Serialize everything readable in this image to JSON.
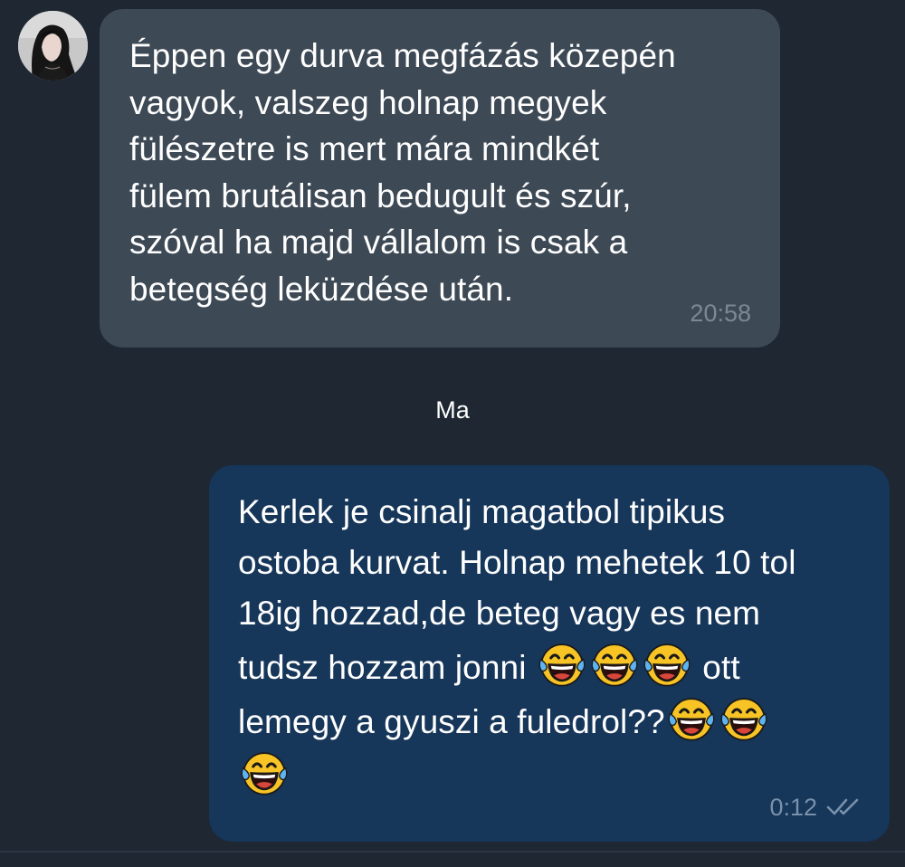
{
  "incoming": {
    "lines": [
      "Éppen egy durva megfázás közepén",
      "vagyok, valszeg holnap megyek",
      "fülészetre is mert mára mindkét",
      "fülem brutálisan bedugult és szúr,",
      "szóval ha majd vállalom is csak a",
      "betegség leküzdése után."
    ],
    "time": "20:58"
  },
  "date_separator": "Ma",
  "outgoing": {
    "line1": "Kerlek je csinalj magatbol tipikus",
    "line2": "ostoba kurvat. Holnap mehetek 10 tol",
    "line3": "18ig hozzad,de beteg vagy es nem",
    "line4": "tudsz hozzam jonni ",
    "line4_tail": " ott",
    "line5": "lemegy a gyuszi a fuledrol??",
    "time": "0:12",
    "emoji": "face-with-tears-of-joy-icon",
    "status": "read-double-check-icon"
  },
  "colors": {
    "background": "#1e2732",
    "incoming_bubble": "#3d4955",
    "outgoing_bubble": "#16365a",
    "emoji_yellow": "#f7c325",
    "emoji_tears": "#5fb3f0"
  }
}
